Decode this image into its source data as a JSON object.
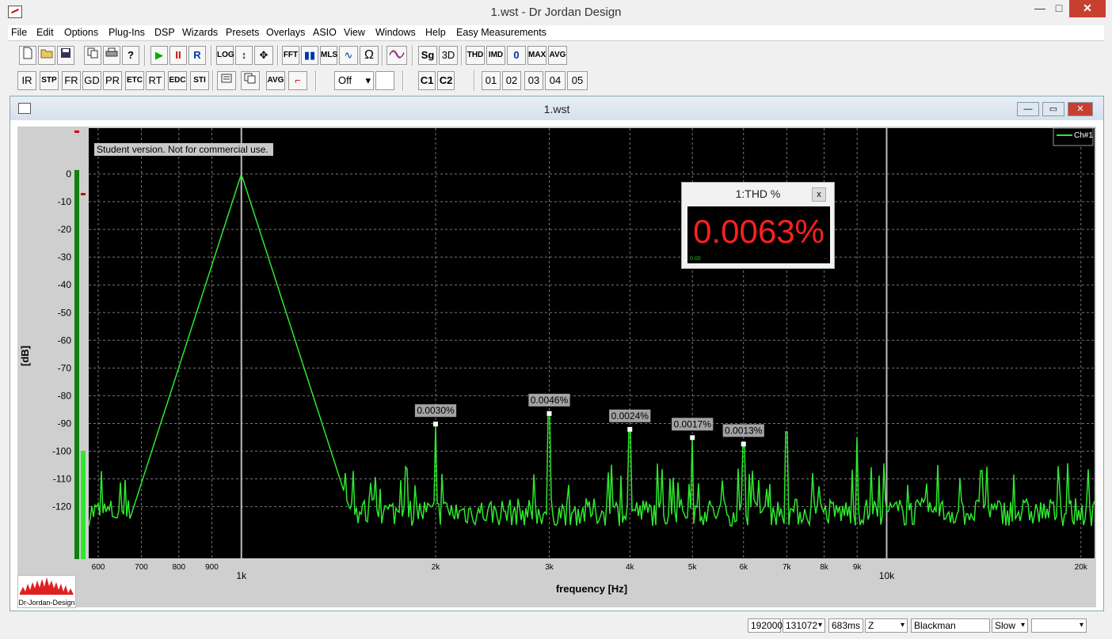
{
  "window": {
    "title": "1.wst - Dr Jordan Design",
    "minimize": "—",
    "maximize": "□",
    "close": "✕"
  },
  "menu": [
    "File",
    "Edit",
    "Options",
    "Plug-Ins",
    "DSP",
    "Wizards",
    "Presets",
    "Overlays",
    "ASIO",
    "View",
    "Windows",
    "Help",
    "Easy Measurements"
  ],
  "toolbar1": [
    "",
    "",
    "",
    "",
    "",
    "",
    "▶",
    "II",
    "R",
    "LOG",
    "↕",
    "✥",
    "FFT",
    "▮▮",
    "MLS",
    "∿",
    "Ω",
    "",
    "Sg",
    "3D",
    "THD",
    "IMD",
    "0",
    "MAX",
    "AVG"
  ],
  "toolbar2": [
    "IR",
    "STP",
    "FR",
    "GD",
    "PR",
    "ETC",
    "RT",
    "EDC",
    "STI",
    "",
    "",
    "AVG",
    "⌐"
  ],
  "toolbar2_select": "Off",
  "toolbar2_channels": [
    "C1",
    "C2"
  ],
  "toolbar2_presets": [
    "01",
    "02",
    "03",
    "04",
    "05"
  ],
  "child": {
    "title": "1.wst"
  },
  "thd": {
    "title": "1:THD %",
    "value": "0.0063%",
    "close": "x",
    "small_left": "0.00",
    "small_right": "--"
  },
  "logo": {
    "text": "Dr-Jordan-Design"
  },
  "status": {
    "rate": "192000",
    "fft": "131072",
    "time": "683ms",
    "weight": "Z",
    "window": "Blackman",
    "speed": "Slow",
    "extra": ""
  },
  "colors": {
    "trace": "#2ee82e",
    "plot_bg": "#000000",
    "thd_value": "#ff2020"
  },
  "chart_data": {
    "type": "line",
    "ylabel": "[dB]",
    "xlabel": "frequency [Hz]",
    "x_scale": "log",
    "xlim": [
      580,
      21000
    ],
    "ylim": [
      -135,
      0
    ],
    "y_ticks": [
      0,
      -10,
      -20,
      -30,
      -40,
      -50,
      -60,
      -70,
      -80,
      -90,
      -100,
      -110,
      -120
    ],
    "x_ticks_minor": [
      {
        "v": 600,
        "l": "600"
      },
      {
        "v": 700,
        "l": "700"
      },
      {
        "v": 800,
        "l": "800"
      },
      {
        "v": 900,
        "l": "900"
      },
      {
        "v": 2000,
        "l": "2k"
      },
      {
        "v": 3000,
        "l": "3k"
      },
      {
        "v": 4000,
        "l": "4k"
      },
      {
        "v": 5000,
        "l": "5k"
      },
      {
        "v": 6000,
        "l": "6k"
      },
      {
        "v": 7000,
        "l": "7k"
      },
      {
        "v": 8000,
        "l": "8k"
      },
      {
        "v": 9000,
        "l": "9k"
      },
      {
        "v": 20000,
        "l": "20k"
      }
    ],
    "x_ticks_major": [
      {
        "v": 1000,
        "l": "1k"
      },
      {
        "v": 10000,
        "l": "10k"
      }
    ],
    "watermark": "Student version. Not for commercial use.",
    "legend": "Ch#1",
    "legend_position": "top-right",
    "grid": true,
    "series": [
      {
        "name": "Ch#1",
        "color": "#2ee82e",
        "noise_floor_db": -122,
        "peaks": [
          {
            "f": 1000,
            "db": 0
          },
          {
            "f": 2000,
            "db": -90.5
          },
          {
            "f": 3000,
            "db": -86.7
          },
          {
            "f": 4000,
            "db": -92.4
          },
          {
            "f": 5000,
            "db": -95.4
          },
          {
            "f": 6000,
            "db": -97.7
          },
          {
            "f": 7000,
            "db": -93
          },
          {
            "f": 9000,
            "db": -95
          },
          {
            "f": 12000,
            "db": -105
          },
          {
            "f": 14000,
            "db": -107
          }
        ]
      }
    ],
    "annotations": [
      {
        "f": 2000,
        "db": -90.5,
        "label": "0.0030%"
      },
      {
        "f": 3000,
        "db": -86.7,
        "label": "0.0046%"
      },
      {
        "f": 4000,
        "db": -92.4,
        "label": "0.0024%"
      },
      {
        "f": 5000,
        "db": -95.4,
        "label": "0.0017%"
      },
      {
        "f": 6000,
        "db": -97.7,
        "label": "0.0013%"
      }
    ]
  }
}
